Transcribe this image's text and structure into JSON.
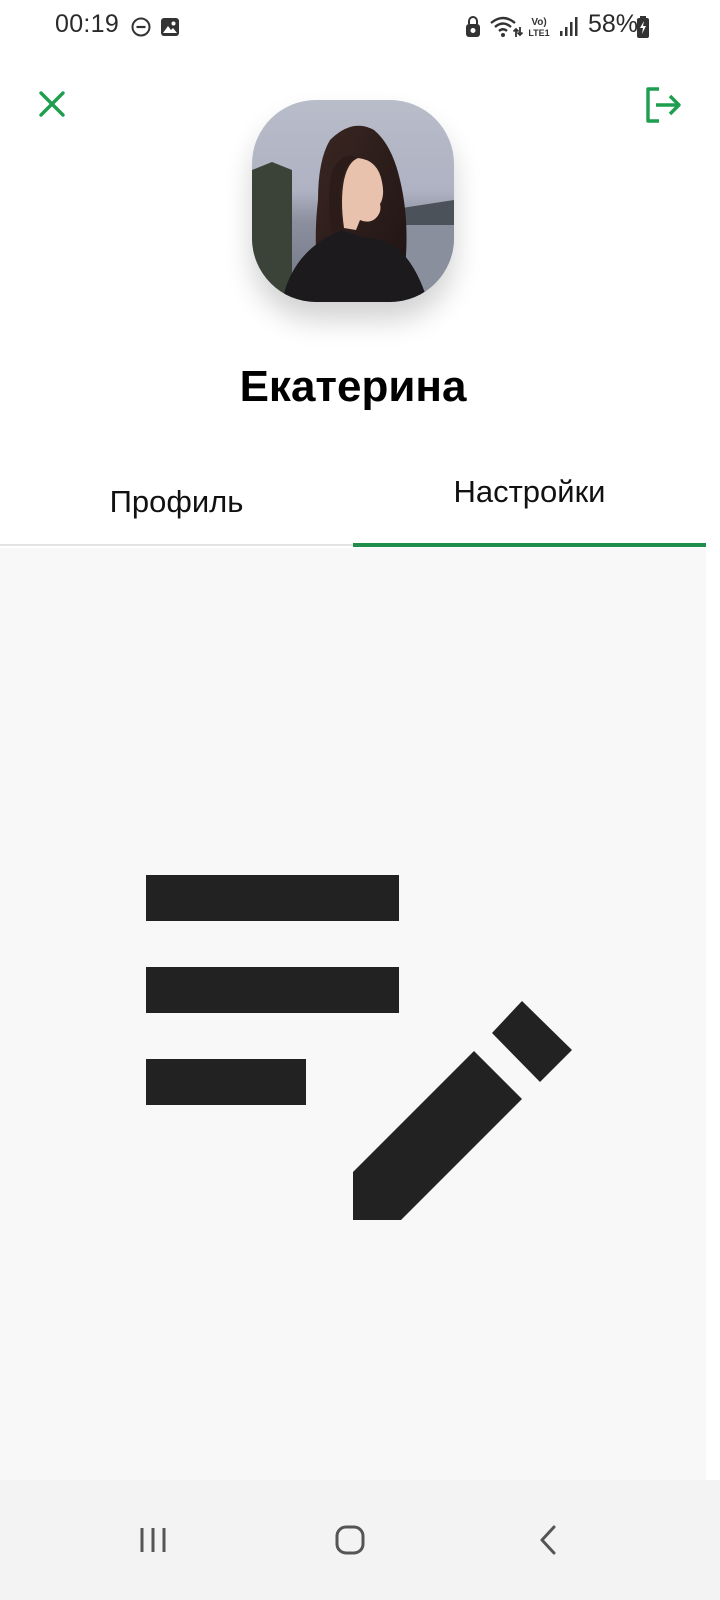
{
  "status_bar": {
    "time": "00:19",
    "battery_percent": "58%",
    "icons": [
      "do-not-disturb-icon",
      "gallery-icon",
      "lock-icon",
      "wifi-icon",
      "volte-icon",
      "signal-icon",
      "battery-icon"
    ]
  },
  "header": {
    "close_icon": "close-icon",
    "logout_icon": "logout-icon",
    "accent_color": "#1e9e4f"
  },
  "profile": {
    "name": "Екатерина",
    "avatar": "user-photo"
  },
  "tabs": [
    {
      "label": "Профиль",
      "selected": false
    },
    {
      "label": "Настройки",
      "selected": true
    }
  ],
  "content": {
    "illustration": "edit-notes-icon"
  },
  "nav_bar": {
    "items": [
      "recents-icon",
      "home-icon",
      "back-icon"
    ]
  }
}
